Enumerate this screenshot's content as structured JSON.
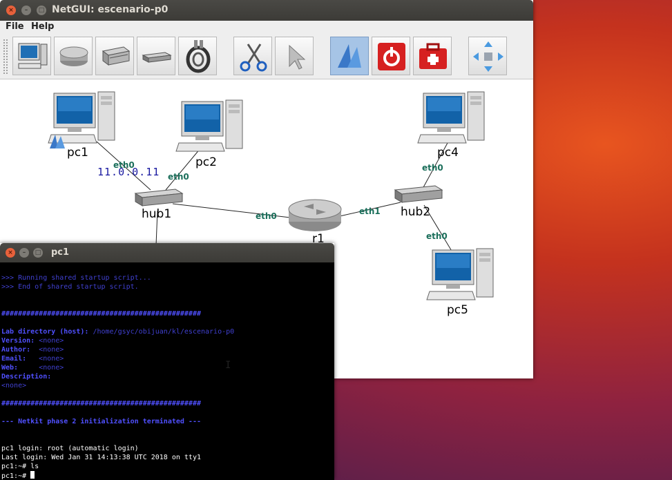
{
  "netgui": {
    "title": "NetGUI: escenario-p0",
    "menu": [
      "File",
      "Help"
    ],
    "toolbar": {
      "buttons": [
        "terminal-tool",
        "router-tool",
        "switch-tool",
        "hub-tool",
        "cable-tool",
        "cut-tool",
        "select-tool",
        "start-tool",
        "stop-tool",
        "tools-tool",
        "move-tool"
      ],
      "active": "start-tool"
    },
    "network": {
      "nodes": {
        "pc1": "pc1",
        "pc2": "pc2",
        "pc4": "pc4",
        "pc5": "pc5",
        "hub1": "hub1",
        "hub2": "hub2",
        "r1": "r1"
      },
      "interfaces": {
        "pc1_if": "eth0",
        "pc2_if": "eth0",
        "pc4_if": "eth0",
        "pc5_if": "eth0",
        "r1_eth0": "eth0",
        "r1_eth1": "eth1"
      },
      "pc1_ip": "11.0.0.11"
    }
  },
  "terminal": {
    "title": "pc1",
    "lines": {
      "l1": ">>> Running shared startup script...",
      "l2": ">>> End of shared startup script.",
      "sep1": "################################################",
      "lab_dir_label": "Lab directory (host):",
      "lab_dir_value": " /home/gsyc/obijuan/kl/escenario-p0",
      "version_label": "Version:",
      "version_value": " <none>",
      "author_label": "Author:",
      "author_value": "  <none>",
      "email_label": "Email:",
      "email_value": "   <none>",
      "web_label": "Web:",
      "web_value": "     <none>",
      "desc_label": "Description:",
      "desc_value": "<none>",
      "sep2": "################################################",
      "phase": "--- Netkit phase 2 initialization terminated ---",
      "login": "pc1 login: root (automatic login)",
      "last_login": "Last login: Wed Jan 31 14:13:38 UTC 2018 on tty1",
      "prompt1": "pc1:~# ls",
      "prompt2": "pc1:~# "
    }
  },
  "colors": {
    "link": "#1a6e5a",
    "ip": "#1818a0",
    "terminal_blue": "#4040d0",
    "active_button": "#a6c4e6"
  }
}
